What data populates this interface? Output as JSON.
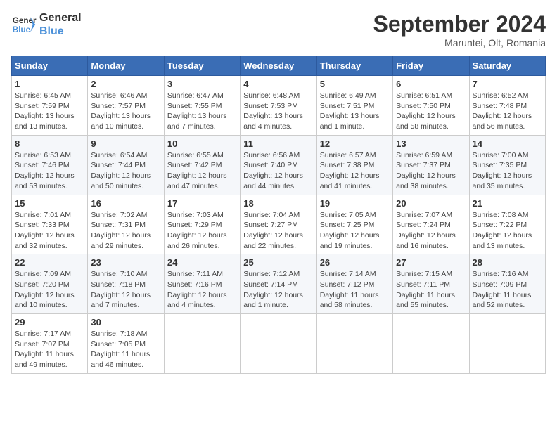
{
  "logo": {
    "text_general": "General",
    "text_blue": "Blue"
  },
  "title": "September 2024",
  "location": "Maruntei, Olt, Romania",
  "weekdays": [
    "Sunday",
    "Monday",
    "Tuesday",
    "Wednesday",
    "Thursday",
    "Friday",
    "Saturday"
  ],
  "weeks": [
    [
      {
        "day": "1",
        "info": "Sunrise: 6:45 AM\nSunset: 7:59 PM\nDaylight: 13 hours\nand 13 minutes."
      },
      {
        "day": "2",
        "info": "Sunrise: 6:46 AM\nSunset: 7:57 PM\nDaylight: 13 hours\nand 10 minutes."
      },
      {
        "day": "3",
        "info": "Sunrise: 6:47 AM\nSunset: 7:55 PM\nDaylight: 13 hours\nand 7 minutes."
      },
      {
        "day": "4",
        "info": "Sunrise: 6:48 AM\nSunset: 7:53 PM\nDaylight: 13 hours\nand 4 minutes."
      },
      {
        "day": "5",
        "info": "Sunrise: 6:49 AM\nSunset: 7:51 PM\nDaylight: 13 hours\nand 1 minute."
      },
      {
        "day": "6",
        "info": "Sunrise: 6:51 AM\nSunset: 7:50 PM\nDaylight: 12 hours\nand 58 minutes."
      },
      {
        "day": "7",
        "info": "Sunrise: 6:52 AM\nSunset: 7:48 PM\nDaylight: 12 hours\nand 56 minutes."
      }
    ],
    [
      {
        "day": "8",
        "info": "Sunrise: 6:53 AM\nSunset: 7:46 PM\nDaylight: 12 hours\nand 53 minutes."
      },
      {
        "day": "9",
        "info": "Sunrise: 6:54 AM\nSunset: 7:44 PM\nDaylight: 12 hours\nand 50 minutes."
      },
      {
        "day": "10",
        "info": "Sunrise: 6:55 AM\nSunset: 7:42 PM\nDaylight: 12 hours\nand 47 minutes."
      },
      {
        "day": "11",
        "info": "Sunrise: 6:56 AM\nSunset: 7:40 PM\nDaylight: 12 hours\nand 44 minutes."
      },
      {
        "day": "12",
        "info": "Sunrise: 6:57 AM\nSunset: 7:38 PM\nDaylight: 12 hours\nand 41 minutes."
      },
      {
        "day": "13",
        "info": "Sunrise: 6:59 AM\nSunset: 7:37 PM\nDaylight: 12 hours\nand 38 minutes."
      },
      {
        "day": "14",
        "info": "Sunrise: 7:00 AM\nSunset: 7:35 PM\nDaylight: 12 hours\nand 35 minutes."
      }
    ],
    [
      {
        "day": "15",
        "info": "Sunrise: 7:01 AM\nSunset: 7:33 PM\nDaylight: 12 hours\nand 32 minutes."
      },
      {
        "day": "16",
        "info": "Sunrise: 7:02 AM\nSunset: 7:31 PM\nDaylight: 12 hours\nand 29 minutes."
      },
      {
        "day": "17",
        "info": "Sunrise: 7:03 AM\nSunset: 7:29 PM\nDaylight: 12 hours\nand 26 minutes."
      },
      {
        "day": "18",
        "info": "Sunrise: 7:04 AM\nSunset: 7:27 PM\nDaylight: 12 hours\nand 22 minutes."
      },
      {
        "day": "19",
        "info": "Sunrise: 7:05 AM\nSunset: 7:25 PM\nDaylight: 12 hours\nand 19 minutes."
      },
      {
        "day": "20",
        "info": "Sunrise: 7:07 AM\nSunset: 7:24 PM\nDaylight: 12 hours\nand 16 minutes."
      },
      {
        "day": "21",
        "info": "Sunrise: 7:08 AM\nSunset: 7:22 PM\nDaylight: 12 hours\nand 13 minutes."
      }
    ],
    [
      {
        "day": "22",
        "info": "Sunrise: 7:09 AM\nSunset: 7:20 PM\nDaylight: 12 hours\nand 10 minutes."
      },
      {
        "day": "23",
        "info": "Sunrise: 7:10 AM\nSunset: 7:18 PM\nDaylight: 12 hours\nand 7 minutes."
      },
      {
        "day": "24",
        "info": "Sunrise: 7:11 AM\nSunset: 7:16 PM\nDaylight: 12 hours\nand 4 minutes."
      },
      {
        "day": "25",
        "info": "Sunrise: 7:12 AM\nSunset: 7:14 PM\nDaylight: 12 hours\nand 1 minute."
      },
      {
        "day": "26",
        "info": "Sunrise: 7:14 AM\nSunset: 7:12 PM\nDaylight: 11 hours\nand 58 minutes."
      },
      {
        "day": "27",
        "info": "Sunrise: 7:15 AM\nSunset: 7:11 PM\nDaylight: 11 hours\nand 55 minutes."
      },
      {
        "day": "28",
        "info": "Sunrise: 7:16 AM\nSunset: 7:09 PM\nDaylight: 11 hours\nand 52 minutes."
      }
    ],
    [
      {
        "day": "29",
        "info": "Sunrise: 7:17 AM\nSunset: 7:07 PM\nDaylight: 11 hours\nand 49 minutes."
      },
      {
        "day": "30",
        "info": "Sunrise: 7:18 AM\nSunset: 7:05 PM\nDaylight: 11 hours\nand 46 minutes."
      },
      {
        "day": "",
        "info": ""
      },
      {
        "day": "",
        "info": ""
      },
      {
        "day": "",
        "info": ""
      },
      {
        "day": "",
        "info": ""
      },
      {
        "day": "",
        "info": ""
      }
    ]
  ]
}
